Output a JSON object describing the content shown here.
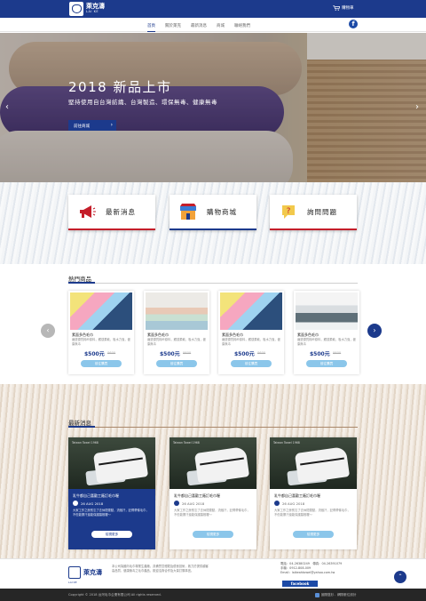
{
  "header": {
    "logo_cn": "萊克濤",
    "logo_en": "LAI KE",
    "cart_label": "購物車"
  },
  "nav": {
    "items": [
      "首頁",
      "關於萊克",
      "最新消息",
      "商城",
      "聯絡我們"
    ],
    "active_index": 0
  },
  "hero": {
    "title": "2018 新品上市",
    "subtitle": "堅持使用自台灣紡織、台灣製造、環保無毒、健康無毒",
    "button": "前往商城",
    "prev": "‹",
    "next": "›"
  },
  "features": [
    {
      "label": "最新消息",
      "icon": "megaphone-icon",
      "accent": "#c41e2a"
    },
    {
      "label": "購物商城",
      "icon": "shop-icon",
      "accent": "#1c3a8c"
    },
    {
      "label": "詢問問題",
      "icon": "question-icon",
      "accent": "#c41e2a"
    }
  ],
  "hot": {
    "title": "熱門商品",
    "products": [
      {
        "name": "素面多色毛巾",
        "desc": "嚴選優質棉紗原料，觸感柔軟，吸水力強，健康無毒",
        "price": "$500元",
        "old": "$600",
        "button": "前往購買"
      },
      {
        "name": "素面多色毛巾",
        "desc": "嚴選優質棉紗原料，觸感柔軟，吸水力強，健康無毒",
        "price": "$500元",
        "old": "$600",
        "button": "前往購買"
      },
      {
        "name": "素面多色毛巾",
        "desc": "嚴選優質棉紗原料，觸感柔軟，吸水力強，健康無毒",
        "price": "$500元",
        "old": "$600",
        "button": "前往購買"
      },
      {
        "name": "素面多色毛巾",
        "desc": "嚴選優質棉紗原料，觸感柔軟，吸水力強，健康無毒",
        "price": "$500元",
        "old": "$600",
        "button": "前往購買"
      }
    ],
    "prev": "‹",
    "next": "›"
  },
  "news": {
    "title": "最新消息",
    "items": [
      {
        "title": "乳牛都自己喜歡工廠訂毛巾喔",
        "date": "26 AUG 2018",
        "desc": "大家工作之餘別忘了去休閒運動，流個汗，記得帶條毛巾，不但能擦汗還能保護頸椎喔～",
        "button": "檢視更多",
        "sign": "Taiwan Towel 1968"
      },
      {
        "title": "乳牛都自己喜歡工廠訂毛巾喔",
        "date": "26 AUG 2018",
        "desc": "大家工作之餘別忘了去休閒運動，流個汗，記得帶條毛巾，不但能擦汗還能保護頸椎喔～",
        "button": "檢視更多",
        "sign": "Taiwan Towel 1968"
      },
      {
        "title": "乳牛都自己喜歡工廠訂毛巾喔",
        "date": "26 AUG 2018",
        "desc": "大家工作之餘別忘了去休閒運動，流個汗，記得帶條毛巾，不但能擦汗還能保護頸椎喔～",
        "button": "檢視更多",
        "sign": "Taiwan Towel 1968"
      }
    ]
  },
  "footer": {
    "logo_cn": "萊克濤",
    "logo_en": "LAI KE",
    "info": "本公司為國內毛巾專業生產廠，具備豐富經驗及優良技術，致力於提供顧客高品質、健康無毒之毛巾產品，歡迎洽詢合作及大量訂購事宜。",
    "tel": "電話：04-26380249　傳真：04-26391079",
    "mobile": "手機：0912-808-009",
    "email": "Email：laikeahtowel@yahoo.com.tw",
    "facebook": "facebook",
    "to_top": "⌃",
    "copyright": "Copyright © 2018 台灣毛巾企業有限公司 All rights reserved.",
    "credit": "國際藍杉．網際數位設計"
  },
  "colors": {
    "brand": "#1c3a8c",
    "accent_red": "#c41e2a",
    "button_light": "#8bc6ea"
  }
}
